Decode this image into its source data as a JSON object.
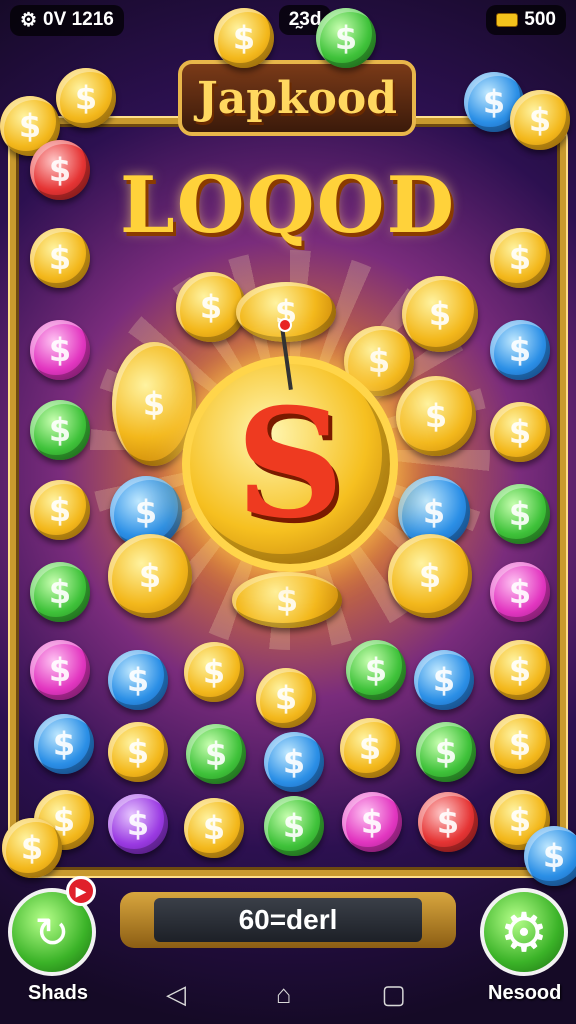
{
  "status_bar": {
    "left_text": "0V 1216",
    "center_text": "2̰3d",
    "coins_value": "500"
  },
  "logo_text": "Japkood",
  "game_title": "LOQOD",
  "score_display": "60=derl",
  "left_button_label": "Shads",
  "right_button_label": "Nesood",
  "coin_symbol": "$",
  "big_coin_symbol": "S",
  "colors": {
    "frame_gold": "#c99a2e",
    "button_green": "#3bb328",
    "title_gold": "#ffd23a"
  },
  "icons": {
    "reload": "reload-icon",
    "settings": "gear-icon",
    "back": "back-triangle-icon",
    "home": "home-icon",
    "recents": "recents-square-icon"
  }
}
